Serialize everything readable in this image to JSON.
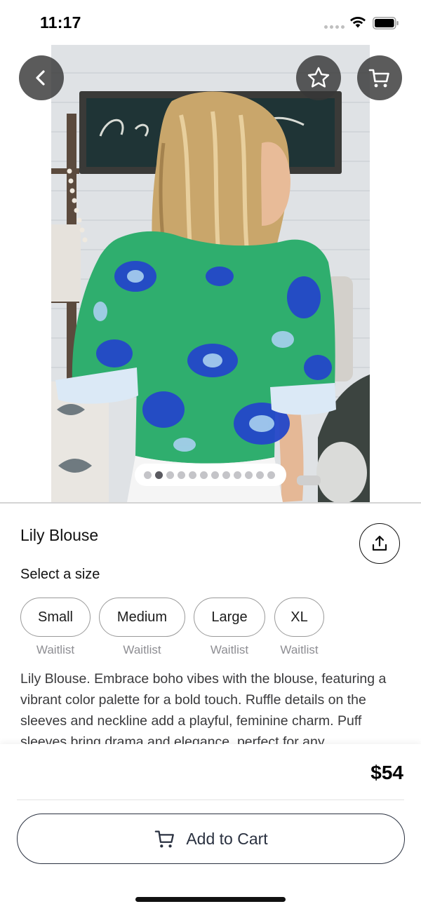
{
  "status_bar": {
    "time": "11:17",
    "icons": [
      "signal-dots-icon",
      "wifi-icon",
      "battery-icon"
    ]
  },
  "top_actions": {
    "icons": [
      "chevron-left-icon",
      "star-icon",
      "shopping-cart-icon"
    ]
  },
  "image_gallery": {
    "page_count": 12,
    "active_index": 1
  },
  "product": {
    "title": "Lily Blouse",
    "select_size_label": "Select a size",
    "sizes": [
      {
        "label": "Small",
        "status": "Waitlist"
      },
      {
        "label": "Medium",
        "status": "Waitlist"
      },
      {
        "label": "Large",
        "status": "Waitlist"
      },
      {
        "label": "XL",
        "status": "Waitlist"
      }
    ],
    "description": "Lily Blouse. Embrace boho vibes with the blouse, featuring a vibrant color palette for a bold touch. Ruffle details on the sleeves and neckline add a playful, feminine charm. Puff sleeves bring drama and elegance, perfect for any"
  },
  "footer": {
    "price": "$54",
    "add_to_cart_label": "Add to Cart"
  },
  "colors": {
    "overlay_button": "#373737",
    "blouse_green": "#2fae6e",
    "blouse_blue": "#2447c9",
    "text_dark": "#1d1d1f",
    "text_muted": "#8e8e93",
    "button_outline": "#2a3140"
  }
}
